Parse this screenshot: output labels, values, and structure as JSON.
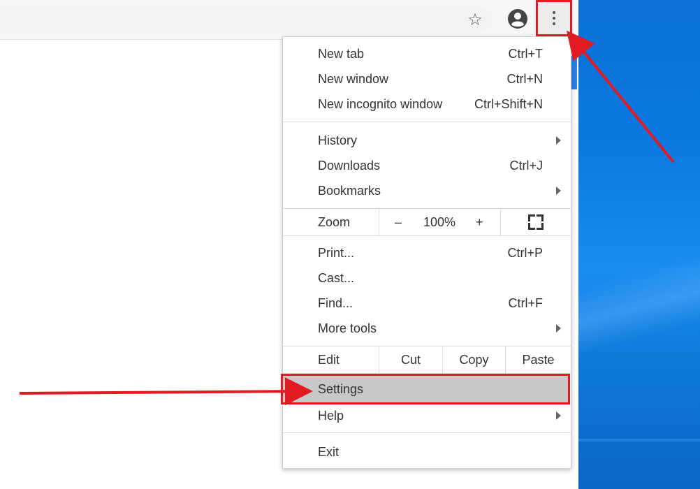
{
  "toolbar": {
    "star_icon": "star-icon",
    "profile_icon": "account-circle-icon",
    "menu_icon": "more-vert-icon"
  },
  "menu": {
    "group1": [
      {
        "label": "New tab",
        "shortcut": "Ctrl+T"
      },
      {
        "label": "New window",
        "shortcut": "Ctrl+N"
      },
      {
        "label": "New incognito window",
        "shortcut": "Ctrl+Shift+N"
      }
    ],
    "group2": [
      {
        "label": "History",
        "shortcut": ""
      },
      {
        "label": "Downloads",
        "shortcut": "Ctrl+J"
      },
      {
        "label": "Bookmarks",
        "shortcut": ""
      }
    ],
    "zoom": {
      "label": "Zoom",
      "minus": "–",
      "value": "100%",
      "plus": "+"
    },
    "group3": [
      {
        "label": "Print...",
        "shortcut": "Ctrl+P"
      },
      {
        "label": "Cast...",
        "shortcut": ""
      },
      {
        "label": "Find...",
        "shortcut": "Ctrl+F"
      },
      {
        "label": "More tools",
        "shortcut": ""
      }
    ],
    "edit": {
      "label": "Edit",
      "cut": "Cut",
      "copy": "Copy",
      "paste": "Paste"
    },
    "settings": "Settings",
    "help": "Help",
    "exit": "Exit"
  },
  "colors": {
    "highlight_border": "#e21b23",
    "arrow": "#e21b23",
    "wallpaper": "#0b79e0"
  }
}
